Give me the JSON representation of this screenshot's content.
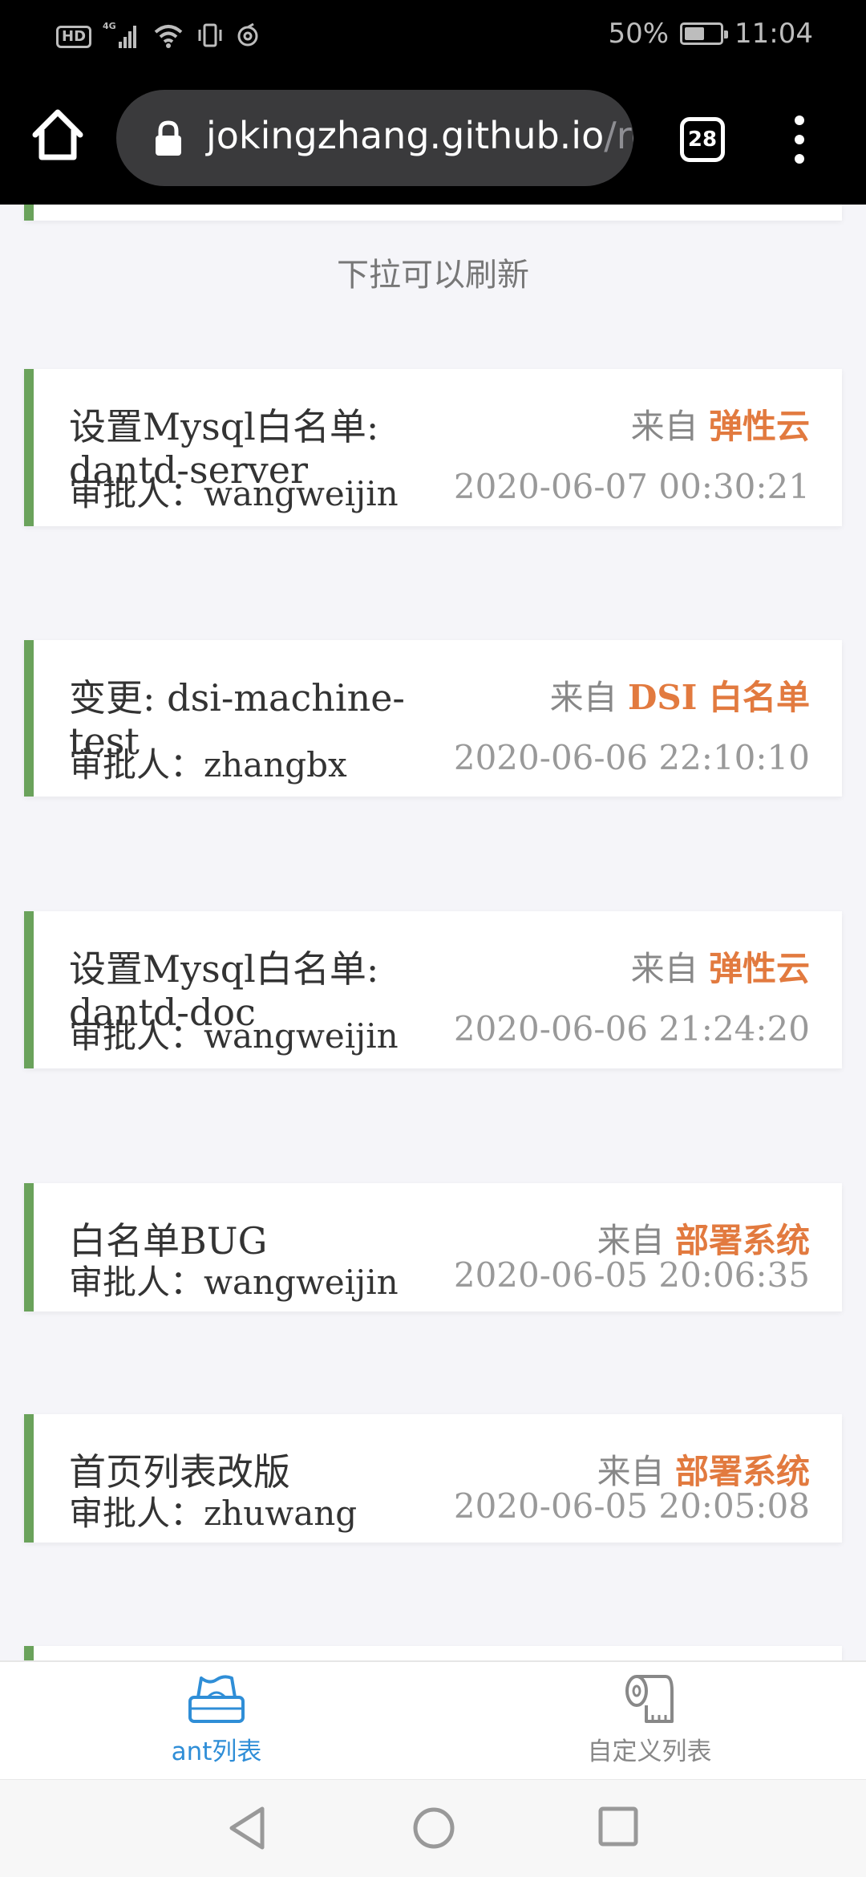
{
  "status_bar": {
    "hd": "HD",
    "network": "4G",
    "battery_percent_text": "50%",
    "battery_level": 0.5,
    "time": "11:04"
  },
  "browser": {
    "url_main": "jokingzhang.github.io",
    "url_rest": "/re",
    "tab_count": "28",
    "icons": [
      "home-icon",
      "lock-icon",
      "tabs-icon",
      "more-vert-icon"
    ]
  },
  "list": {
    "pull_hint": "下拉可以刷新",
    "source_prefix": "来自",
    "approver_prefix": "审批人：",
    "items": [
      {
        "title": "设置Mysql白名单: dantd-server",
        "source": "弹性云",
        "approver": "wangweijin",
        "time": "2020-06-07 00:30:21"
      },
      {
        "title": "变更: dsi-machine-test",
        "source": "DSI 白名单",
        "approver": "zhangbx",
        "time": "2020-06-06 22:10:10"
      },
      {
        "title": "设置Mysql白名单: dantd-doc",
        "source": "弹性云",
        "approver": "wangweijin",
        "time": "2020-06-06 21:24:20"
      },
      {
        "title": "白名单BUG",
        "source": "部署系统",
        "approver": "wangweijin",
        "time": "2020-06-05 20:06:35"
      },
      {
        "title": "首页列表改版",
        "source": "部署系统",
        "approver": "zhuwang",
        "time": "2020-06-05 20:05:08"
      }
    ]
  },
  "tabbar": {
    "tabs": [
      {
        "label": "ant列表",
        "icon": "tissue-box-icon",
        "active": true
      },
      {
        "label": "自定义列表",
        "icon": "toilet-paper-icon",
        "active": false
      }
    ]
  },
  "colors": {
    "accent_green": "#6aa25b",
    "source_orange": "#e27a3f",
    "tab_active_blue": "#2f8ed7"
  }
}
